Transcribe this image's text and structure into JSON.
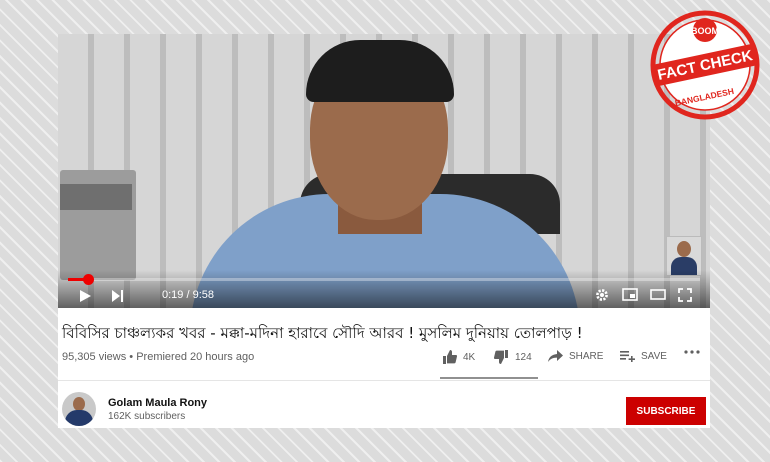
{
  "video": {
    "current_time": "0:19",
    "duration": "9:58",
    "progress_fraction": 0.032,
    "accent_color": "#ee0000"
  },
  "info": {
    "title": "বিবিসির চাঞ্চল্যকর খবর - মক্কা-মদিনা হারাবে সৌদি আরব ! মুসলিম দুনিয়ায় তোলপাড় !",
    "views": "95,305 views",
    "premiered": "Premiered 20 hours ago"
  },
  "actions": {
    "like_count": "4K",
    "dislike_count": "124",
    "share_label": "SHARE",
    "save_label": "SAVE",
    "icons": [
      "thumbs-up-icon",
      "thumbs-down-icon",
      "share-icon",
      "playlist-add-icon",
      "more-icon"
    ]
  },
  "channel": {
    "name": "Golam Maula Rony",
    "subscribers": "162K subscribers",
    "subscribe_label": "SUBSCRIBE",
    "subscribe_color": "#cc0000"
  },
  "badge": {
    "top_text": "BOOM",
    "main_text": "FACT CHECK",
    "bottom_text": "BANGLADESH",
    "color": "#e0261e"
  }
}
